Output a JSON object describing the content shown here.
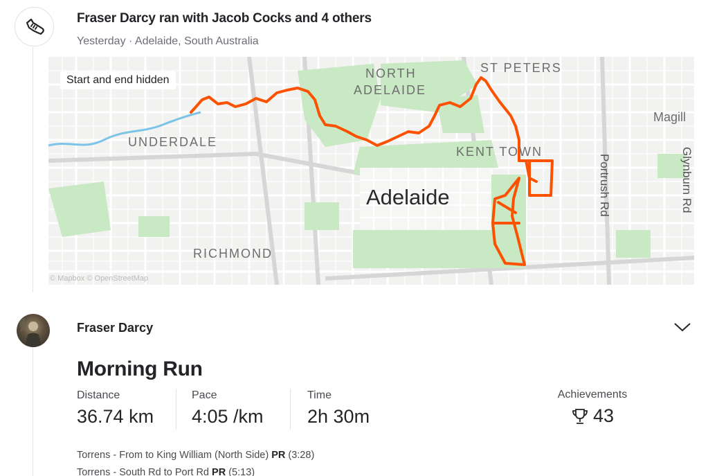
{
  "group": {
    "icon": "running-shoe-icon",
    "title": "Fraser Darcy ran with Jacob Cocks and 4 others",
    "subtitle": "Yesterday · Adelaide, South Australia"
  },
  "map": {
    "hidden_badge": "Start and end hidden",
    "attribution": "© Mapbox © OpenStreetMap",
    "city_label": "Adelaide",
    "suburbs": [
      "NORTH",
      "ADELAIDE",
      "ST PETERS",
      "KENT TOWN",
      "UNDERDALE",
      "RICHMOND",
      "Magill"
    ],
    "roads": [
      "Portrush Rd",
      "Glynburn Rd"
    ],
    "route_color": "#fc5200",
    "park_color": "#c9e8c4",
    "river_color": "#7cc3e8"
  },
  "athlete": {
    "name": "Fraser Darcy",
    "avatar": "athlete-photo"
  },
  "activity": {
    "title": "Morning Run",
    "stats": [
      {
        "label": "Distance",
        "value": "36.74 km"
      },
      {
        "label": "Pace",
        "value": "4:05 /km"
      },
      {
        "label": "Time",
        "value": "2h 30m"
      }
    ],
    "achievements": {
      "label": "Achievements",
      "value": "43",
      "icon": "trophy-icon"
    }
  },
  "segments": [
    {
      "name": "Torrens - From to King William (North Side)",
      "badge": "PR",
      "time": "(3:28)"
    },
    {
      "name": "Torrens - South Rd to Port Rd",
      "badge": "PR",
      "time": "(5:13)"
    }
  ]
}
